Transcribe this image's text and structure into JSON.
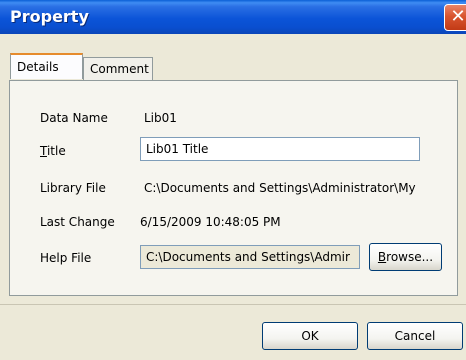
{
  "window": {
    "title": "Property",
    "close_glyph": "✕"
  },
  "tabs": [
    {
      "label": "Details",
      "selected": true
    },
    {
      "label": "Comment",
      "selected": false
    }
  ],
  "fields": {
    "data_name": {
      "label": "Data Name",
      "value": "Lib01"
    },
    "title": {
      "label_first": "T",
      "label_rest": "itle",
      "value": "Lib01 Title"
    },
    "library_file": {
      "label": "Library File",
      "value": "C:\\Documents and Settings\\Administrator\\My"
    },
    "last_change": {
      "label": "Last Change",
      "value": "6/15/2009 10:48:05 PM"
    },
    "help_file": {
      "label": "Help File",
      "value": "C:\\Documents and Settings\\Admir"
    }
  },
  "buttons": {
    "browse_first": "B",
    "browse_rest": "rowse...",
    "ok": "OK",
    "cancel": "Cancel"
  },
  "colors": {
    "titlebar": "#0b54d8",
    "tab_highlight": "#e68b2c",
    "close": "#d9552f"
  }
}
